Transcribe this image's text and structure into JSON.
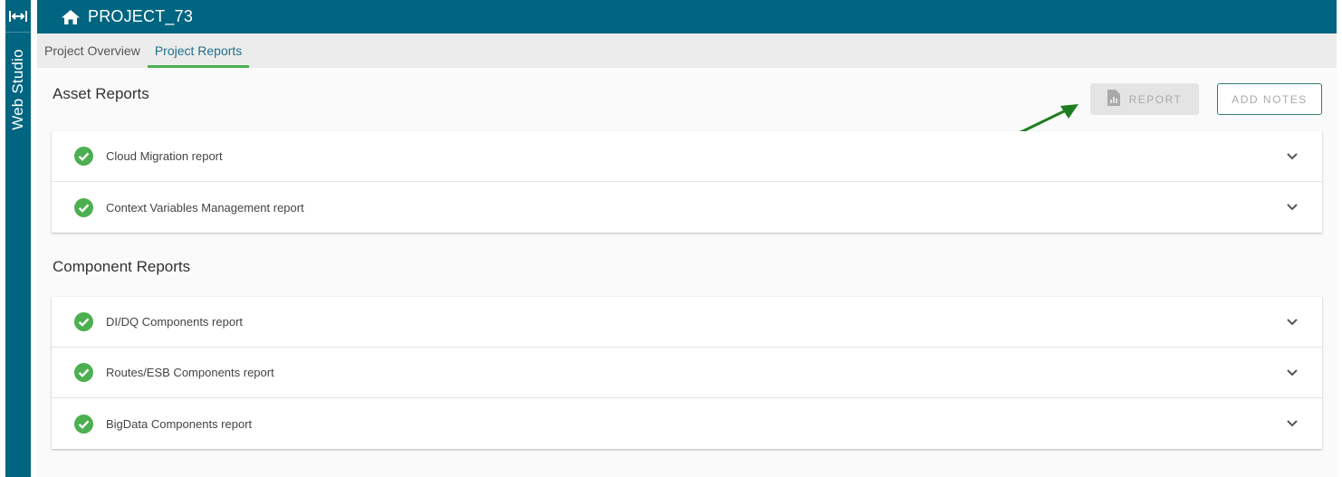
{
  "sidebar": {
    "label": "Web Studio",
    "toggle_icon": "expand-horizontal-icon",
    "color": "#006580"
  },
  "header": {
    "home_icon": "home-icon",
    "project_title": "PROJECT_73",
    "color": "#006580"
  },
  "tabs": [
    {
      "label": "Project Overview",
      "active": false
    },
    {
      "label": "Project Reports",
      "active": true
    }
  ],
  "asset_section": {
    "title": "Asset Reports",
    "report_button": {
      "label": "REPORT",
      "icon": "report-file-icon",
      "disabled": true
    },
    "notes_button": {
      "label": "ADD NOTES"
    },
    "items": [
      {
        "label": "Cloud Migration report",
        "status": "complete"
      },
      {
        "label": "Context Variables Management report",
        "status": "complete"
      }
    ]
  },
  "component_section": {
    "title": "Component Reports",
    "items": [
      {
        "label": "DI/DQ Components report",
        "status": "complete"
      },
      {
        "label": "Routes/ESB Components report",
        "status": "complete"
      },
      {
        "label": "BigData Components report",
        "status": "complete"
      }
    ]
  },
  "colors": {
    "accent_tab": "#4caf50",
    "status_complete": "#4caf50",
    "annotation_arrow": "#1e7d1e"
  }
}
